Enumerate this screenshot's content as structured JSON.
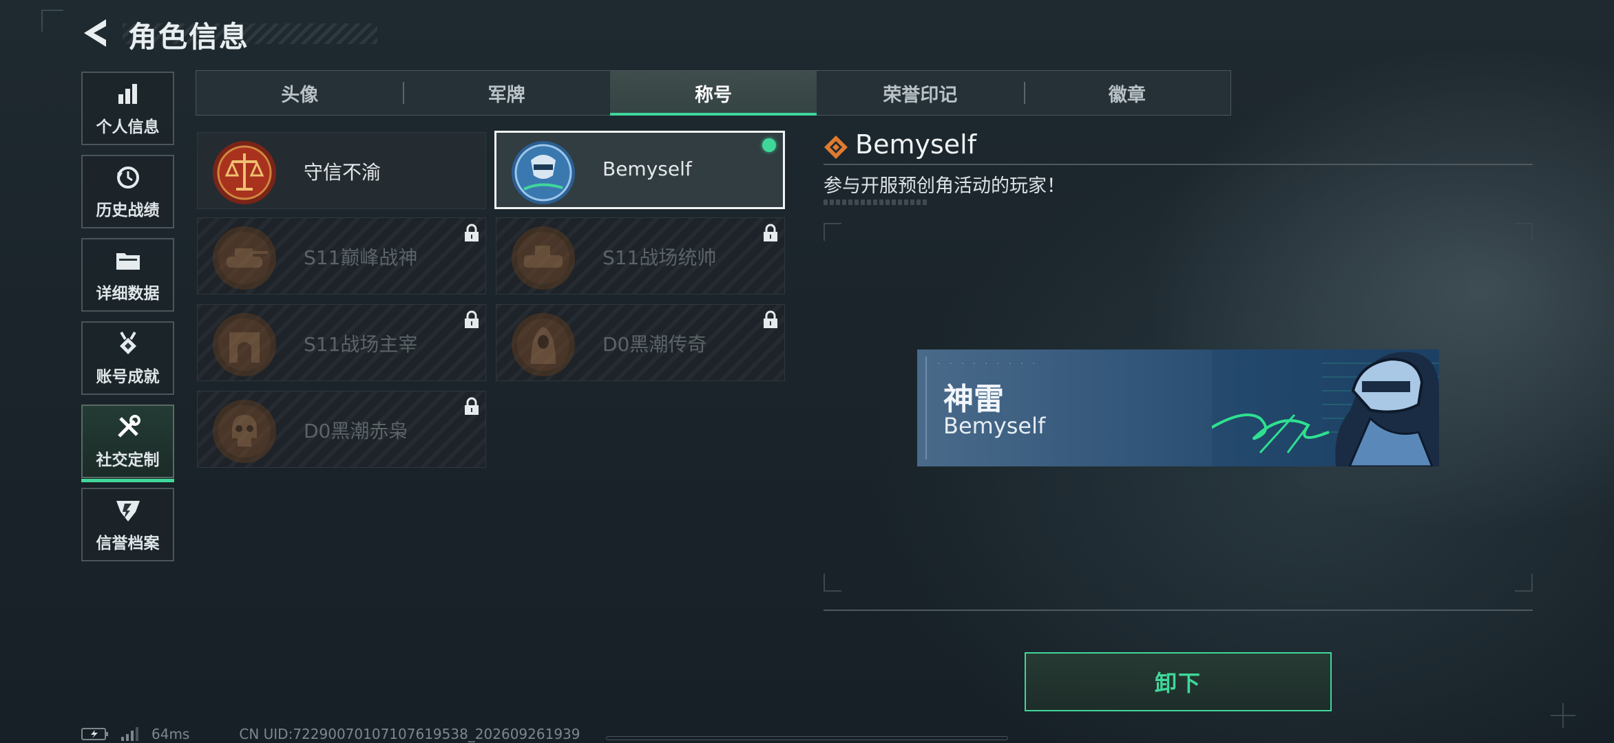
{
  "header": {
    "title": "角色信息",
    "back_icon": "back-arrow-icon"
  },
  "sidebar": {
    "items": [
      {
        "label": "个人信息",
        "icon": "bar-chart-icon",
        "active": false
      },
      {
        "label": "历史战绩",
        "icon": "history-clock-icon",
        "active": false
      },
      {
        "label": "详细数据",
        "icon": "folder-icon",
        "active": false
      },
      {
        "label": "账号成就",
        "icon": "medal-icon",
        "active": false
      },
      {
        "label": "社交定制",
        "icon": "tools-icon",
        "active": true
      },
      {
        "label": "信誉档案",
        "icon": "shield-emblem-icon",
        "active": false
      }
    ]
  },
  "tabs": [
    {
      "label": "头像",
      "active": false
    },
    {
      "label": "军牌",
      "active": false
    },
    {
      "label": "称号",
      "active": true
    },
    {
      "label": "荣誉印记",
      "active": false
    },
    {
      "label": "徽章",
      "active": false
    }
  ],
  "titles": [
    {
      "label": "守信不渝",
      "locked": false,
      "selected": false,
      "equipped": false
    },
    {
      "label": "Bemyself",
      "locked": false,
      "selected": true,
      "equipped": true
    },
    {
      "label": "S11巅峰战神",
      "locked": true,
      "selected": false,
      "equipped": false
    },
    {
      "label": "S11战场统帅",
      "locked": true,
      "selected": false,
      "equipped": false
    },
    {
      "label": "S11战场主宰",
      "locked": true,
      "selected": false,
      "equipped": false
    },
    {
      "label": "D0黑潮传奇",
      "locked": true,
      "selected": false,
      "equipped": false
    },
    {
      "label": "D0黑潮赤枭",
      "locked": true,
      "selected": false,
      "equipped": false
    }
  ],
  "detail": {
    "name": "Bemyself",
    "description": "参与开服预创角活动的玩家！",
    "banner": {
      "title_cn": "神雷",
      "title_en": "Bemyself"
    }
  },
  "actions": {
    "unequip_label": "卸下"
  },
  "status": {
    "ping": "64ms",
    "uid": "CN UID:72290070107107619538_202609261939"
  },
  "colors": {
    "accent": "#3fd79a",
    "background": "#1c262c",
    "banner": "#2c5478"
  }
}
